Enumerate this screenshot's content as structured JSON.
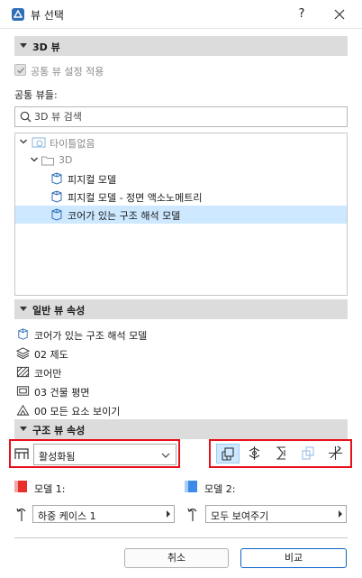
{
  "window": {
    "title": "뷰 선택",
    "help_label": "?"
  },
  "section_3d": {
    "label": "3D 뷰"
  },
  "common_settings": {
    "label": "공통 뷰 설정 적용",
    "checked": true
  },
  "common_views_label": "공통 뷰들:",
  "search": {
    "placeholder": "3D 뷰 검색",
    "value": ""
  },
  "tree": {
    "root_label": "타이틀없음",
    "folder_label": "3D",
    "items": [
      {
        "label": "피지컬 모델"
      },
      {
        "label": "피지컬 모델 - 정면 액소노메트리"
      },
      {
        "label": "코어가 있는 구조 해석 모델",
        "selected": true
      }
    ]
  },
  "section_general": {
    "label": "일반 뷰 속성",
    "items": [
      {
        "label": "코어가 있는 구조 해석 모델",
        "icon": "analytical-model-icon"
      },
      {
        "label": "02 제도",
        "icon": "layers-icon"
      },
      {
        "label": "코어만",
        "icon": "hatch-icon"
      },
      {
        "label": "03 건물 평면",
        "icon": "plan-icon"
      },
      {
        "label": "00 모든 요소 보이기",
        "icon": "model-view-icon"
      }
    ]
  },
  "section_structural": {
    "label": "구조 뷰 속성",
    "mode_dropdown": {
      "value": "활성화됨"
    },
    "tools": [
      "structural-display-icon",
      "support-icon",
      "member-icon",
      "surface-icon",
      "axis-icon"
    ],
    "model1": {
      "label": "모델 1:",
      "color": "#e8302a",
      "dropdown": "하중 케이스 1"
    },
    "model2": {
      "label": "모델 2:",
      "color": "#3c8be8",
      "dropdown": "모두 보여주기"
    }
  },
  "buttons": {
    "cancel": "취소",
    "compare": "비교"
  },
  "colors": {
    "highlight": "#e8101a",
    "selection": "#cde8ff",
    "accent_blue": "#0a64c8"
  }
}
